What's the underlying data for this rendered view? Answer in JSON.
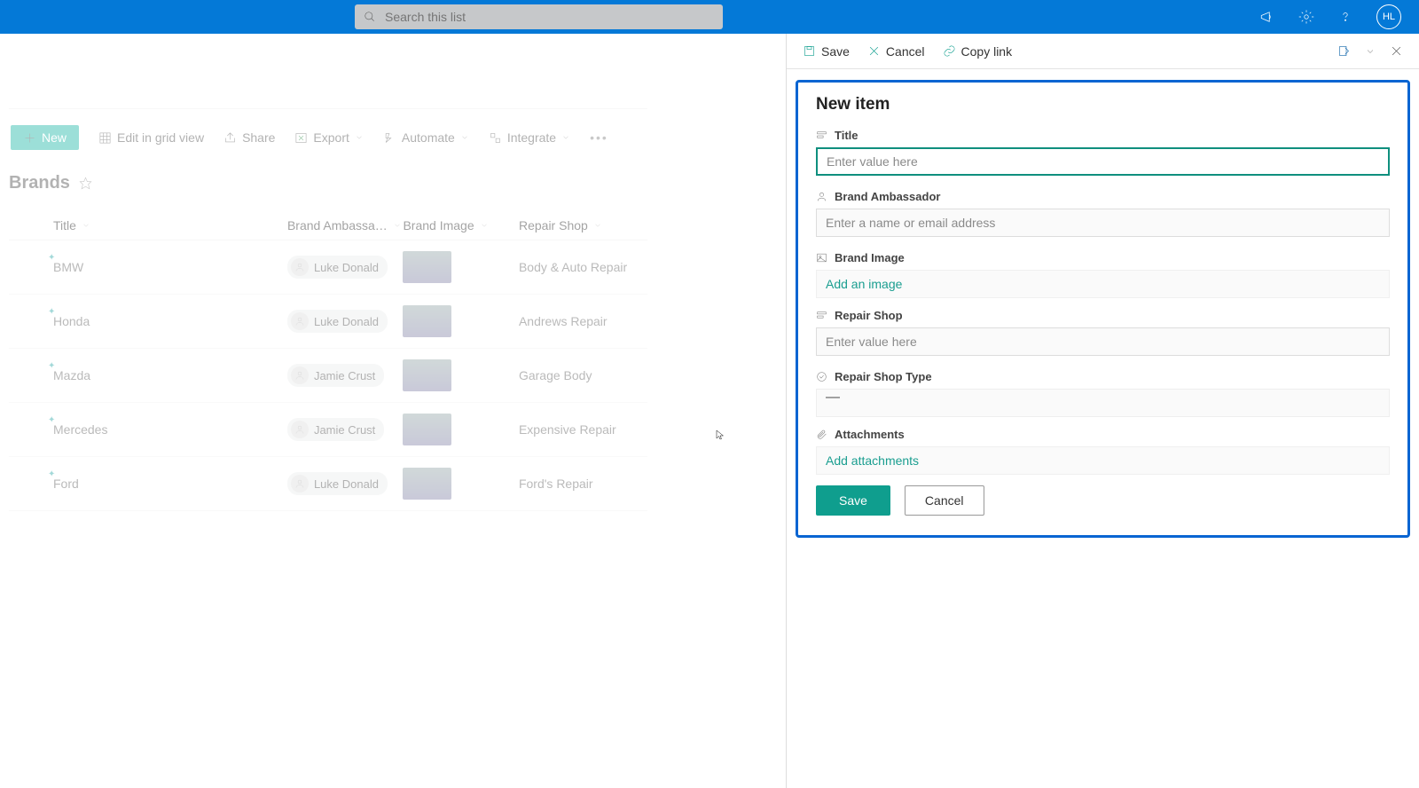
{
  "topbar": {
    "search_placeholder": "Search this list",
    "avatar_initials": "HL"
  },
  "cmdbar": {
    "new": "New",
    "edit_grid": "Edit in grid view",
    "share": "Share",
    "export": "Export",
    "automate": "Automate",
    "integrate": "Integrate"
  },
  "list": {
    "title": "Brands",
    "columns": {
      "title": "Title",
      "ambassador": "Brand Ambassa…",
      "image": "Brand Image",
      "shop": "Repair Shop"
    },
    "rows": [
      {
        "title": "BMW",
        "ambassador": "Luke Donald",
        "shop": "Body & Auto Repair"
      },
      {
        "title": "Honda",
        "ambassador": "Luke Donald",
        "shop": "Andrews Repair"
      },
      {
        "title": "Mazda",
        "ambassador": "Jamie Crust",
        "shop": "Garage Body"
      },
      {
        "title": "Mercedes",
        "ambassador": "Jamie Crust",
        "shop": "Expensive Repair"
      },
      {
        "title": "Ford",
        "ambassador": "Luke Donald",
        "shop": "Ford's Repair"
      }
    ]
  },
  "panel": {
    "cmd": {
      "save": "Save",
      "cancel": "Cancel",
      "copylink": "Copy link"
    },
    "heading": "New item",
    "fields": {
      "title_label": "Title",
      "title_placeholder": "Enter value here",
      "ambassador_label": "Brand Ambassador",
      "ambassador_placeholder": "Enter a name or email address",
      "image_label": "Brand Image",
      "image_action": "Add an image",
      "shop_label": "Repair Shop",
      "shop_placeholder": "Enter value here",
      "shoptype_label": "Repair Shop Type",
      "shoptype_value": "—",
      "attachments_label": "Attachments",
      "attachments_action": "Add attachments"
    },
    "buttons": {
      "save": "Save",
      "cancel": "Cancel"
    }
  }
}
